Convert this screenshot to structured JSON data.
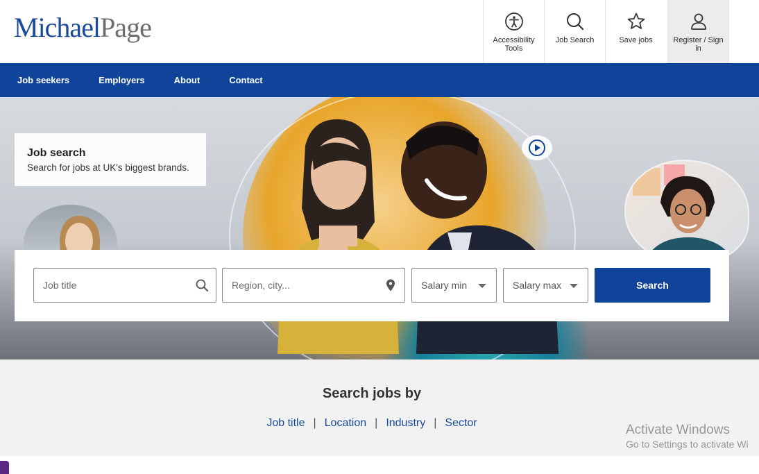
{
  "brand": {
    "part1": "Michael",
    "part2": "Page",
    "color_primary": "#1a4a9c",
    "color_secondary": "#6d6e71"
  },
  "utility": [
    {
      "label": "Accessibility Tools",
      "icon": "accessibility-icon"
    },
    {
      "label": "Job Search",
      "icon": "search-icon"
    },
    {
      "label": "Save jobs",
      "icon": "star-icon"
    },
    {
      "label": "Register / Sign in",
      "icon": "user-icon"
    }
  ],
  "nav": {
    "color": "#10449a",
    "items": [
      "Job seekers",
      "Employers",
      "About",
      "Contact"
    ]
  },
  "hero": {
    "title": "Job search",
    "subtitle": "Search for jobs at UK's biggest brands.",
    "play_icon": "play-icon"
  },
  "search": {
    "job_title_placeholder": "Job title",
    "location_placeholder": "Region, city...",
    "salary_min": "Salary min",
    "salary_max": "Salary max",
    "button_label": "Search"
  },
  "search_by": {
    "heading": "Search jobs by",
    "links": [
      "Job title",
      "Location",
      "Industry",
      "Sector"
    ]
  },
  "watermark": {
    "line1": "Activate Windows",
    "line2": "Go to Settings to activate Wi"
  }
}
